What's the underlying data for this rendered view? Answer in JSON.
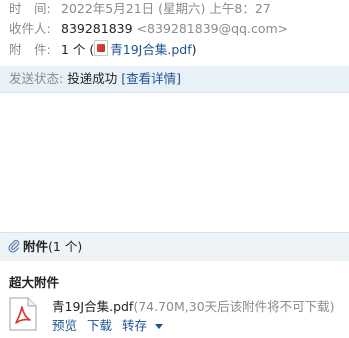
{
  "header": {
    "time_label": "时　间:",
    "time_value": "2022年5月21日 (星期六) 上午8：27",
    "recipient_label": "收件人:",
    "recipient_name": "839281839",
    "recipient_email": "<839281839@qq.com>",
    "attachment_label": "附　件:",
    "attachment_count": "1 个 (",
    "attachment_file": "青19J合集.pdf",
    "attachment_close": ")"
  },
  "status": {
    "label": "发送状态:",
    "value": "投递成功",
    "details_link": "[查看详情]"
  },
  "attachments": {
    "section_title": "附件",
    "section_count": "(1 个)",
    "big_title": "超大附件",
    "file_name": "青19J合集.pdf",
    "file_meta": "(74.70M,30天后该附件将不可下载)",
    "preview": "预览",
    "download": "下载",
    "save": "转存"
  },
  "colors": {
    "link": "#1e5494",
    "status_bg": "#e8f0f8",
    "muted": "#8b8b8b"
  }
}
